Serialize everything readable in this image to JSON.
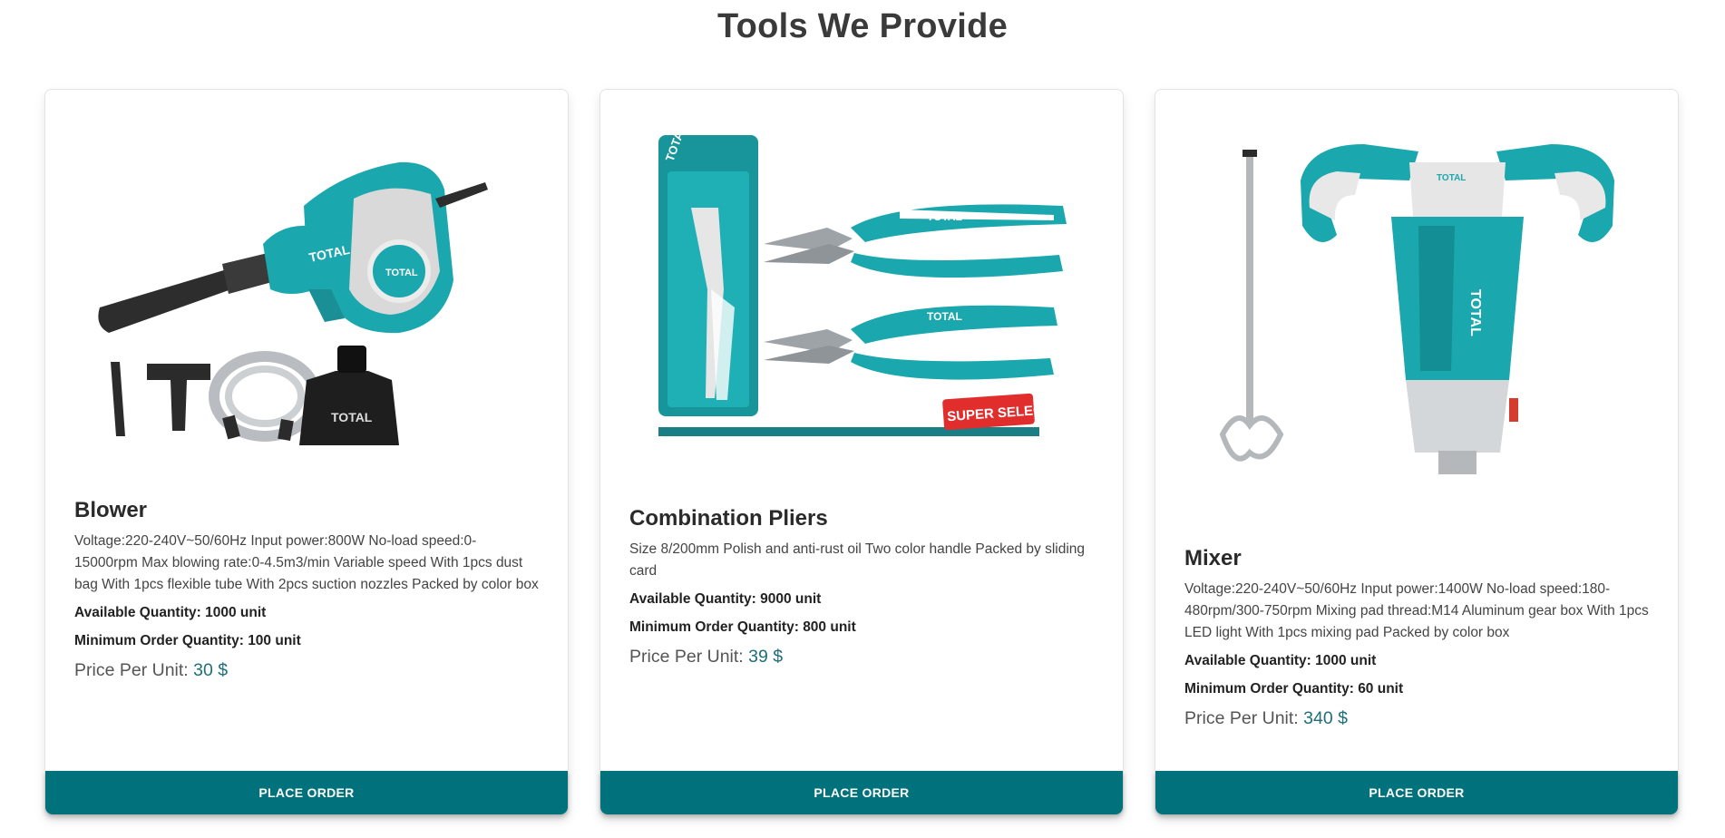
{
  "section": {
    "title": "Tools We Provide"
  },
  "products": [
    {
      "image_icon": "blower-with-accessories",
      "brand": "TOTAL",
      "name": "Blower",
      "description": "Voltage:220-240V~50/60Hz Input power:800W No-load speed:0-15000rpm Max blowing rate:0-4.5m3/min Variable speed With 1pcs dust bag With 1pcs flexible tube With 2pcs suction nozzles Packed by color box",
      "available_label": "Available Quantity:",
      "available_value": "1000 unit",
      "min_order_label": "Minimum Order Quantity:",
      "min_order_value": "100 unit",
      "price_label": "Price Per Unit:",
      "price_value": "30 $",
      "button_label": "PLACE ORDER"
    },
    {
      "image_icon": "combination-pliers",
      "brand": "TOTAL",
      "badge": "SUPER SELECT",
      "name": "Combination Pliers",
      "description": "Size 8/200mm Polish and anti-rust oil Two color handle Packed by sliding card",
      "available_label": "Available Quantity:",
      "available_value": "9000 unit",
      "min_order_label": "Minimum Order Quantity:",
      "min_order_value": "800 unit",
      "price_label": "Price Per Unit:",
      "price_value": "39 $",
      "button_label": "PLACE ORDER"
    },
    {
      "image_icon": "paint-mixer",
      "brand": "TOTAL",
      "name": "Mixer",
      "description": "Voltage:220-240V~50/60Hz Input power:1400W No-load speed:180-480rpm/300-750rpm Mixing pad thread:M14 Aluminum gear box With 1pcs LED light With 1pcs mixing pad Packed by color box",
      "available_label": "Available Quantity:",
      "available_value": "1000 unit",
      "min_order_label": "Minimum Order Quantity:",
      "min_order_value": "60 unit",
      "price_label": "Price Per Unit:",
      "price_value": "340 $",
      "button_label": "PLACE ORDER"
    }
  ],
  "colors": {
    "accent": "#01727c",
    "tool_teal": "#1aa7ad",
    "price": "#1f6f7a"
  }
}
